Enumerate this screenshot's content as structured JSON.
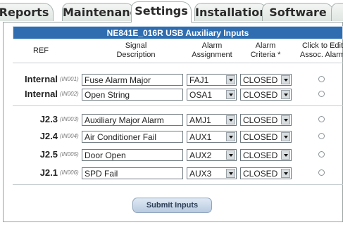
{
  "tabs": [
    {
      "label": "Reports"
    },
    {
      "label": "Maintenance"
    },
    {
      "label": "Settings"
    },
    {
      "label": "Installation"
    },
    {
      "label": "Software"
    }
  ],
  "panel": {
    "title": "NE841E_016R USB Auxiliary Inputs"
  },
  "headers": {
    "ref": "REF",
    "signal_1": "Signal",
    "signal_2": "Description",
    "alarm_1": "Alarm",
    "alarm_2": "Assignment",
    "criteria_1": "Alarm",
    "criteria_2": "Criteria *",
    "edit_1": "Click to Edit",
    "edit_2": "Assoc. Alarm"
  },
  "rows": [
    {
      "ref": "Internal",
      "input": "(IN001)",
      "signal": "Fuse Alarm Major",
      "alarm": "FAJ1",
      "criteria": "CLOSED"
    },
    {
      "ref": "Internal",
      "input": "(IN002)",
      "signal": "Open String",
      "alarm": "OSA1",
      "criteria": "CLOSED"
    },
    {
      "ref": "J2.3",
      "input": "(IN003)",
      "signal": "Auxiliary Major Alarm",
      "alarm": "AMJ1",
      "criteria": "CLOSED"
    },
    {
      "ref": "J2.4",
      "input": "(IN004)",
      "signal": "Air Conditioner Fail",
      "alarm": "AUX1",
      "criteria": "CLOSED"
    },
    {
      "ref": "J2.5",
      "input": "(IN005)",
      "signal": "Door Open",
      "alarm": "AUX2",
      "criteria": "CLOSED"
    },
    {
      "ref": "J2.1",
      "input": "(IN006)",
      "signal": "SPD Fail",
      "alarm": "AUX3",
      "criteria": "CLOSED"
    }
  ],
  "submit_label": "Submit Inputs",
  "colors": {
    "title_bar": "#2f6db0",
    "button": "#c8d8ea"
  }
}
